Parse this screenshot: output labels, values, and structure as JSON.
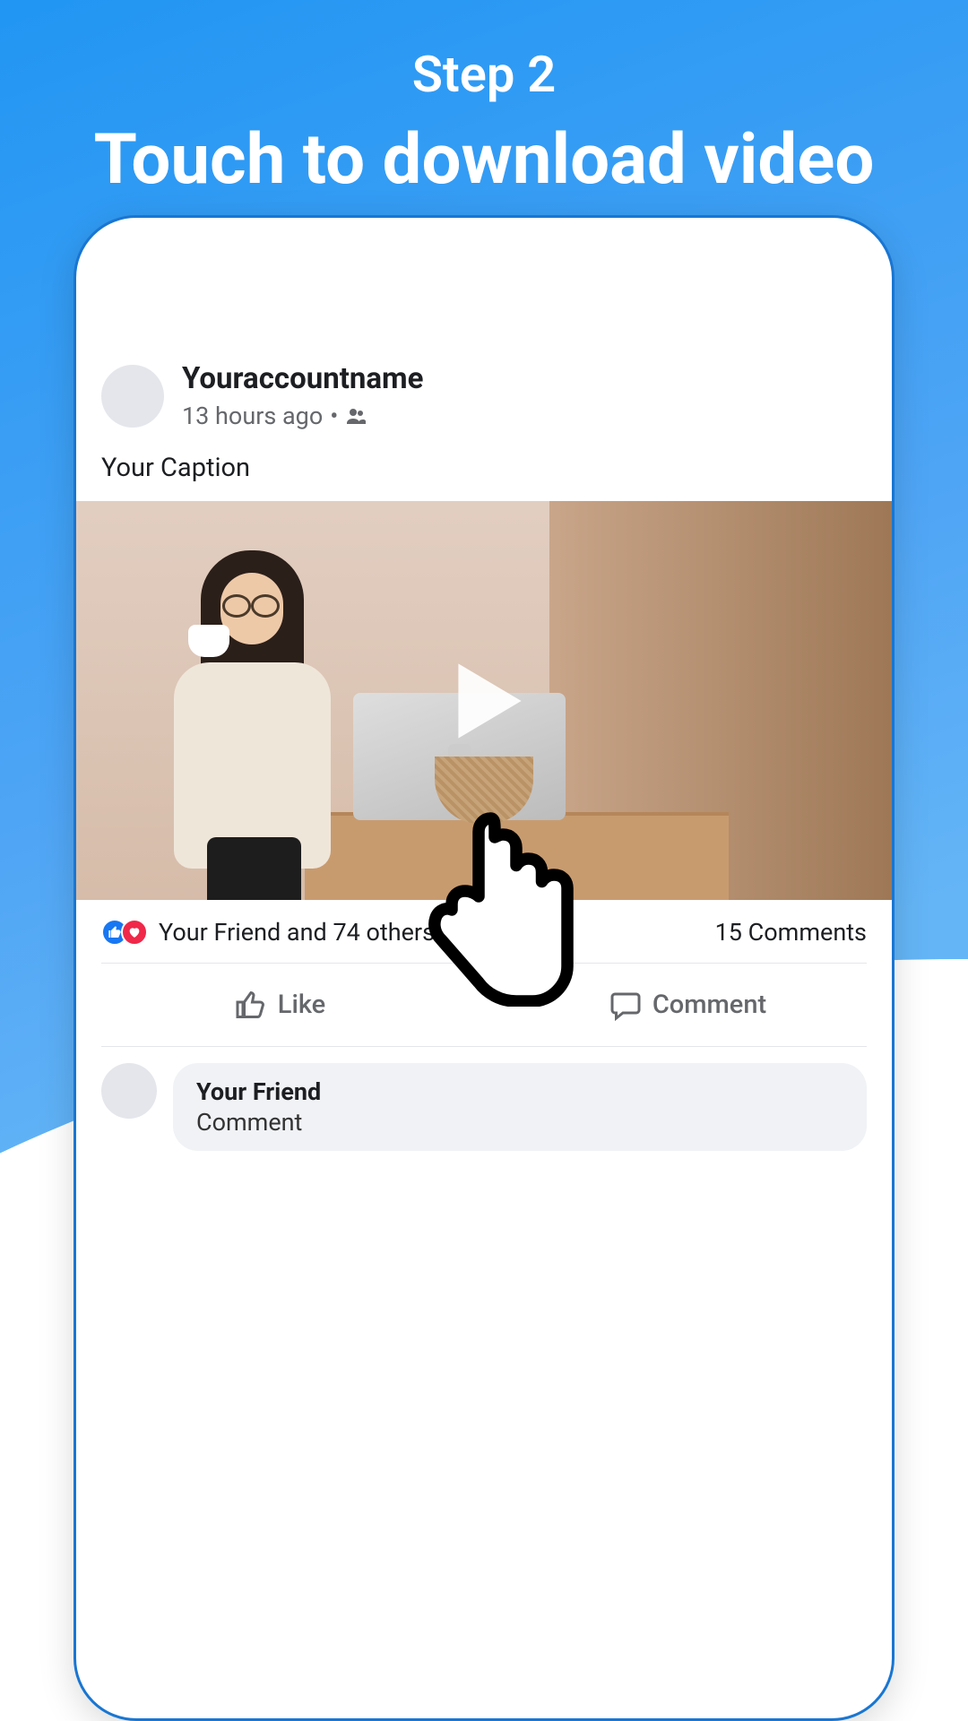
{
  "header": {
    "step": "Step 2",
    "title": "Touch to download video"
  },
  "post": {
    "account_name": "Youraccountname",
    "time_ago": "13 hours ago",
    "caption": "Your Caption"
  },
  "stats": {
    "likes_text": "Your Friend and 74 others",
    "comments_text": "15 Comments"
  },
  "actions": {
    "like_label": "Like",
    "comment_label": "Comment"
  },
  "comment": {
    "author": "Your Friend",
    "text": "Comment"
  }
}
